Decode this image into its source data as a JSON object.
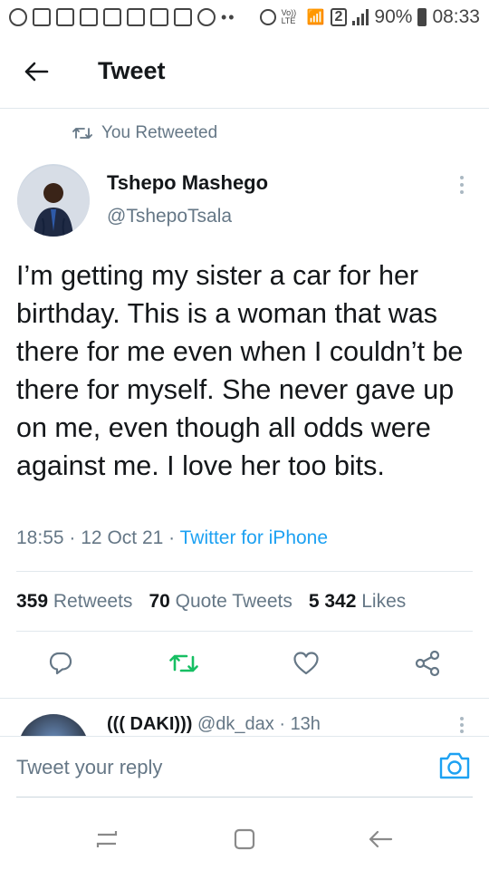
{
  "status_bar": {
    "volte": "Vo)) LTE",
    "sim": "2",
    "battery": "90%",
    "time": "08:33"
  },
  "header": {
    "title": "Tweet",
    "back_icon": "arrow-left-icon"
  },
  "retweet_context": {
    "label": "You Retweeted",
    "icon": "retweet-icon"
  },
  "tweet": {
    "author_name": "Tshepo Mashego",
    "author_handle": "@TshepoTsala",
    "text": "I’m getting my sister a car for her birthday. This is a woman that was there for me even when I couldn’t be there for myself. She never gave up on me, even though all odds were against me. I love her too bits.",
    "time": "18:55",
    "date": "12 Oct 21",
    "source": "Twitter for iPhone",
    "separator": "·"
  },
  "stats": {
    "retweets_count": "359",
    "retweets_label": "Retweets",
    "quotes_count": "70",
    "quotes_label": "Quote Tweets",
    "likes_count": "5 342",
    "likes_label": "Likes"
  },
  "actions": {
    "reply_icon": "reply-icon",
    "retweet_icon": "retweet-icon",
    "like_icon": "heart-icon",
    "share_icon": "share-icon",
    "retweet_active_color": "#17bf63"
  },
  "reply_preview": {
    "name": "((( DAKI)))",
    "handle": "@dk_dax",
    "time": "13h"
  },
  "reply_bar": {
    "placeholder": "Tweet your reply",
    "camera_icon": "camera-icon"
  },
  "colors": {
    "accent": "#1da1f2",
    "secondary_text": "#657786",
    "primary_text": "#14171a"
  }
}
